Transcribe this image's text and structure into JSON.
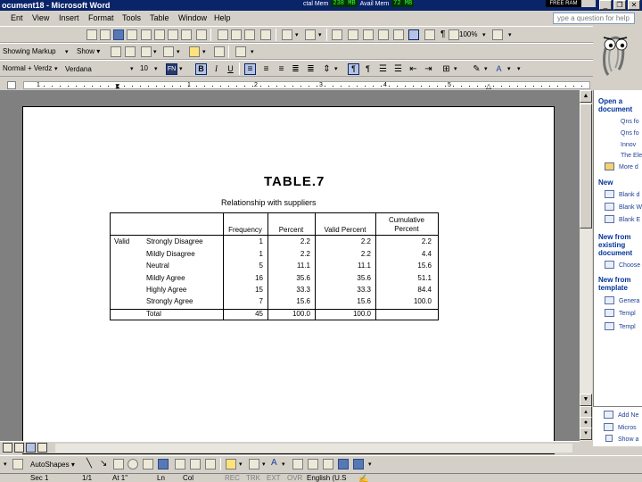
{
  "window": {
    "title": "ocument18 - Microsoft Word",
    "memory": {
      "total_label": "ctal Mem",
      "total_value": "238 MB",
      "avail_label": "Avail Mem",
      "avail_value": "72 MB",
      "free_label": "FREE RAM"
    },
    "buttons": {
      "minimize": "_",
      "restore": "❐",
      "close": "✕"
    }
  },
  "menu": {
    "items": [
      "Ent",
      "View",
      "Insert",
      "Format",
      "Tools",
      "Table",
      "Window",
      "Help"
    ],
    "help_placeholder": "ype a question for help"
  },
  "toolbar": {
    "zoom": "100%",
    "markup_view": "Showing Markup",
    "show_label": "Show ▾",
    "style": "Normal + Verdz",
    "font": "Verdana",
    "font_size": "10",
    "bold": "B",
    "italic": "I",
    "underline": "U"
  },
  "ruler": {
    "numbers": [
      "1",
      "1",
      "2",
      "3",
      "4",
      "5"
    ]
  },
  "document": {
    "table_title": "TABLE.7",
    "caption": "Relationship with suppliers",
    "headers": {
      "frequency": "Frequency",
      "percent": "Percent",
      "valid_percent": "Valid Percent",
      "cumulative_1": "Cumulative",
      "cumulative_2": "Percent"
    },
    "row_group": "Valid",
    "rows": [
      {
        "label": "Strongly Disagree",
        "frequency": "1",
        "percent": "2.2",
        "valid_percent": "2.2",
        "cumulative": "2.2"
      },
      {
        "label": "Mildly Disagree",
        "frequency": "1",
        "percent": "2.2",
        "valid_percent": "2.2",
        "cumulative": "4.4"
      },
      {
        "label": "Neutral",
        "frequency": "5",
        "percent": "11.1",
        "valid_percent": "11.1",
        "cumulative": "15.6"
      },
      {
        "label": "Mildly Agree",
        "frequency": "16",
        "percent": "35.6",
        "valid_percent": "35.6",
        "cumulative": "51.1"
      },
      {
        "label": "Highly Agree",
        "frequency": "15",
        "percent": "33.3",
        "valid_percent": "33.3",
        "cumulative": "84.4"
      },
      {
        "label": "Strongly Agree",
        "frequency": "7",
        "percent": "15.6",
        "valid_percent": "15.6",
        "cumulative": "100.0"
      }
    ],
    "total": {
      "label": "Total",
      "frequency": "45",
      "percent": "100.0",
      "valid_percent": "100.0"
    }
  },
  "taskpane": {
    "open_heading": "Open a document",
    "open_links": [
      "Qns fo",
      "Qns fo",
      "Innov",
      "The Ele"
    ],
    "more_label": "More d",
    "new_heading": "New",
    "new_links": [
      "Blank d",
      "Blank W",
      "Blank E"
    ],
    "existing_heading": "New from existing document",
    "choose_label": "Choose",
    "template_heading": "New from template",
    "template_links": [
      "Genera",
      "Templ",
      "Templ"
    ],
    "bottom_links": [
      "Add Ne",
      "Micros",
      "Show a"
    ]
  },
  "drawing": {
    "draw_label": "▾",
    "autoshapes": "AutoShapes ▾"
  },
  "status": {
    "page": "Sec 1",
    "position": "1/1",
    "at": "At 1\"",
    "ln": "Ln",
    "col": "Col",
    "rec": "REC",
    "trk": "TRK",
    "ext": "EXT",
    "ovr": "OVR",
    "language": "English (U.S"
  }
}
